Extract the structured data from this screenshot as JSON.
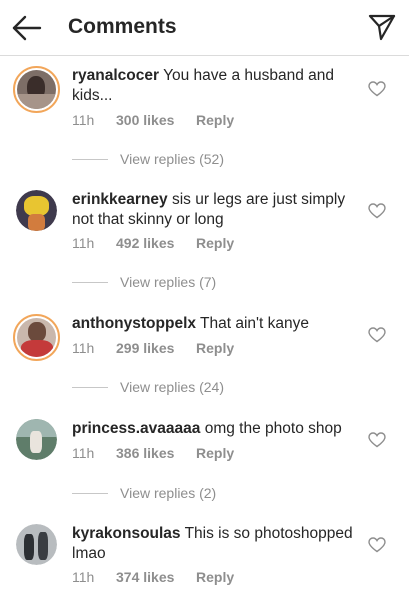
{
  "header": {
    "title": "Comments",
    "back_icon": "arrow-left-icon",
    "send_icon": "paper-plane-icon"
  },
  "comments": [
    {
      "username": "ryanalcocer",
      "text": "You have a husband and kids...",
      "time": "11h",
      "likes": "300 likes",
      "reply": "Reply",
      "view_replies": "View replies (52)"
    },
    {
      "username": "erinkkearney",
      "text": "sis ur legs are just simply not that skinny or long",
      "time": "11h",
      "likes": "492 likes",
      "reply": "Reply",
      "view_replies": "View replies (7)"
    },
    {
      "username": "anthonystoppelx",
      "text": "That ain't kanye",
      "time": "11h",
      "likes": "299 likes",
      "reply": "Reply",
      "view_replies": "View replies (24)"
    },
    {
      "username": "princess.avaaaaa",
      "text": "omg the photo shop",
      "time": "11h",
      "likes": "386 likes",
      "reply": "Reply",
      "view_replies": "View replies (2)"
    },
    {
      "username": "kyrakonsoulas",
      "text": "This is so photoshopped lmao",
      "time": "11h",
      "likes": "374 likes",
      "reply": "Reply"
    }
  ],
  "colors": {
    "text": "#262626",
    "muted": "#8e8e8e",
    "story_ring": "#f2a65a",
    "divider": "#dbdbdb"
  }
}
